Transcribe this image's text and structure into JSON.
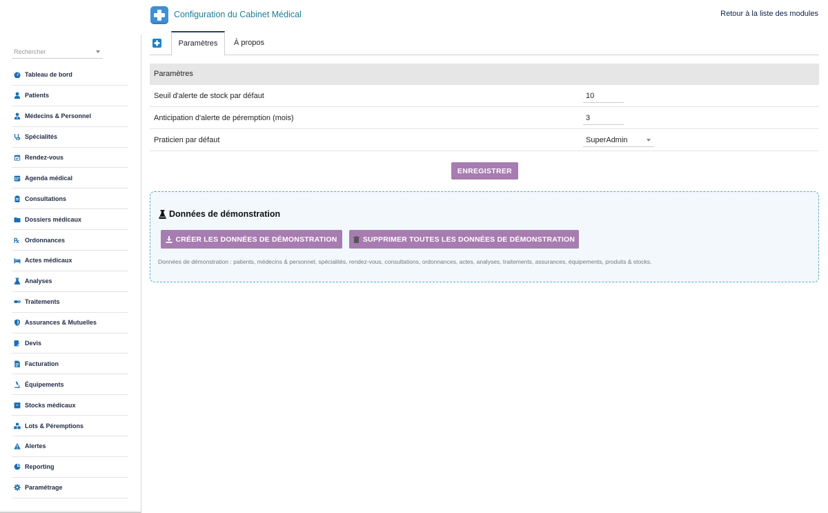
{
  "header": {
    "title": "Configuration du Cabinet Médical",
    "back_link": "Retour à la liste des modules"
  },
  "sidebar": {
    "search_placeholder": "Rechercher",
    "items": [
      {
        "label": "Tableau de bord",
        "icon": "dashboard-icon"
      },
      {
        "label": "Patients",
        "icon": "user-icon"
      },
      {
        "label": "Médecins & Personnel",
        "icon": "doctor-icon"
      },
      {
        "label": "Spécialités",
        "icon": "stethoscope-icon"
      },
      {
        "label": "Rendez-vous",
        "icon": "calendar-check-icon"
      },
      {
        "label": "Agenda médical",
        "icon": "calendar-icon"
      },
      {
        "label": "Consultations",
        "icon": "clipboard-icon"
      },
      {
        "label": "Dossiers médicaux",
        "icon": "folder-icon"
      },
      {
        "label": "Ordonnances",
        "icon": "prescription-icon"
      },
      {
        "label": "Actes médicaux",
        "icon": "bed-icon"
      },
      {
        "label": "Analyses",
        "icon": "flask-icon"
      },
      {
        "label": "Traitements",
        "icon": "pills-icon"
      },
      {
        "label": "Assurances & Mutuelles",
        "icon": "shield-icon"
      },
      {
        "label": "Devis",
        "icon": "edit-document-icon"
      },
      {
        "label": "Facturation",
        "icon": "invoice-icon"
      },
      {
        "label": "Équipements",
        "icon": "microscope-icon"
      },
      {
        "label": "Stocks médicaux",
        "icon": "box-icon"
      },
      {
        "label": "Lots & Péremptions",
        "icon": "boxes-icon"
      },
      {
        "label": "Alertes",
        "icon": "warning-icon"
      },
      {
        "label": "Reporting",
        "icon": "pie-chart-icon"
      },
      {
        "label": "Paramétrage",
        "icon": "gear-icon"
      }
    ]
  },
  "tabs": {
    "active": "Paramètres",
    "about": "À propos"
  },
  "params": {
    "heading": "Paramètres",
    "rows": [
      {
        "label": "Seuil d'alerte de stock par défaut",
        "value": "10"
      },
      {
        "label": "Anticipation d'alerte de péremption (mois)",
        "value": "3"
      },
      {
        "label": "Praticien par défaut",
        "value": "SuperAdmin"
      }
    ],
    "save_label": "ENREGISTRER"
  },
  "demo": {
    "title": "Données de démonstration",
    "create_label": "CRÉER LES DONNÉES DE DÉMONSTRATION",
    "delete_label": "SUPPRIMER TOUTES LES DONNÉES DE DÉMONSTRATION",
    "note": "Données de démonstration : patients, médecins & personnel, spécialités, rendez-vous, consultations, ordonnances, actes, analyses, traitements, assurances, équipements, produits & stocks."
  },
  "colors": {
    "accent": "#a77cb0",
    "title": "#1b7f94",
    "logo": "#3d8fd6",
    "sidebar_icon": "#1b6fb0",
    "demo_border": "#5aa8c8"
  }
}
